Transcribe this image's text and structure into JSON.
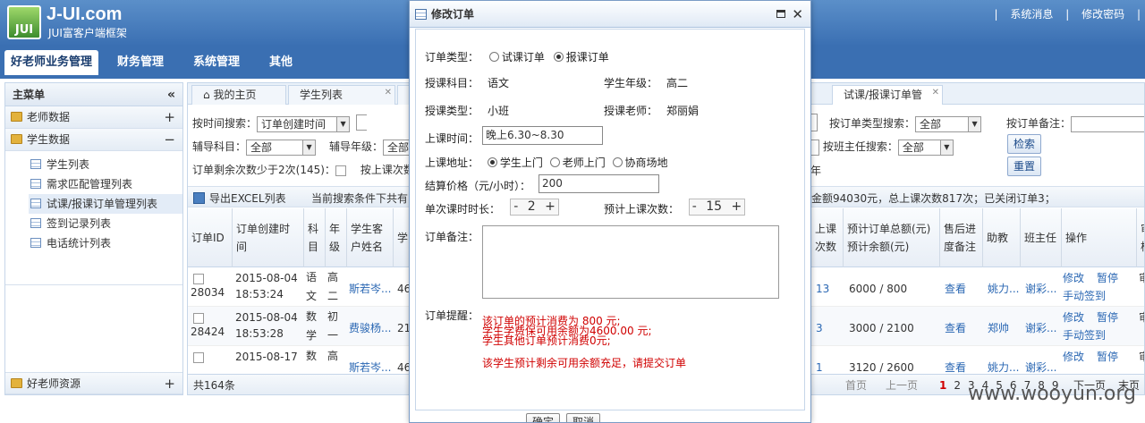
{
  "header": {
    "logo_text": "JUI",
    "title": "J-UI.com",
    "subtitle": "JUI富客户端框架",
    "links": [
      "|",
      "系统消息",
      "|",
      "修改密码",
      "|"
    ]
  },
  "nav": {
    "items": [
      "好老师业务管理",
      "财务管理",
      "系统管理",
      "其他"
    ]
  },
  "sidebar": {
    "title": "主菜单",
    "collapse": "«",
    "sections": [
      {
        "label": "老师数据",
        "toggle": "+"
      },
      {
        "label": "学生数据",
        "toggle": "−"
      }
    ],
    "items": [
      "学生列表",
      "需求匹配管理列表",
      "试课/报课订单管理列表",
      "签到记录列表",
      "电话统计列表"
    ],
    "bottom": {
      "label": "好老师资源",
      "toggle": "+"
    }
  },
  "tabs": [
    {
      "label": "我的主页"
    },
    {
      "label": "学生列表"
    },
    {
      "label": "试课/报课订单管"
    }
  ],
  "search": {
    "time_label": "按时间搜索：",
    "time_value": "订单创建时间",
    "subject_label": "辅导科目：",
    "subject_value": "全部",
    "grade_label": "辅导年级：",
    "grade_value": "全部",
    "remain_label": "订单剩余次数少于2次(145)：",
    "last_label": "按上课次数",
    "type_label": "按订单类型搜索：",
    "type_value": "全部",
    "note_label": "按订单备注：",
    "head_label": "按班主任搜索：",
    "head_value": "全部",
    "search_btn": "检索",
    "reset_btn": "重置",
    "nian": "年"
  },
  "toolbar": {
    "export": "导出EXCEL列表",
    "summary": "当前搜索条件下共有",
    "summary_right": "金额94030元，总上课次数817次；已关闭订单3；"
  },
  "grid": {
    "headers": [
      "订单ID",
      "订单创建时间",
      "科目",
      "年级",
      "学生客户姓名",
      "学",
      "上课次数",
      "预计订单总额(元) 预计余额(元)",
      "售后进度备注",
      "助教",
      "班主任",
      "操作",
      "审核"
    ],
    "rows": [
      {
        "id": "28034",
        "date": "2015-08-04",
        "time": "18:53:24",
        "subj": "语文",
        "grade": "高二",
        "name": "斯若岑...",
        "x": "46",
        "times": "13",
        "money": "6000 / 800",
        "view": "查看",
        "ta": "姚力...",
        "head": "谢彩...",
        "op1": "修改",
        "op2": "暂停",
        "op3": "手动签到",
        "aud": "审通"
      },
      {
        "id": "28424",
        "date": "2015-08-04",
        "time": "18:53:28",
        "subj": "数学",
        "grade": "初一",
        "name": "费骏杨...",
        "x": "21",
        "times": "3",
        "money": "3000 / 2100",
        "view": "查看",
        "ta": "郑帅",
        "head": "谢彩...",
        "op1": "修改",
        "op2": "暂停",
        "op3": "手动签到",
        "aud": "审通"
      },
      {
        "id": "",
        "date": "2015-08-17",
        "time": "",
        "subj": "数",
        "grade": "高",
        "name": "斯若岑...",
        "x": "46",
        "times": "1",
        "money": "3120 / 2600",
        "view": "查看",
        "ta": "姚力...",
        "head": "谢彩...",
        "op1": "修改",
        "op2": "暂停",
        "op3": "",
        "aud": "审"
      }
    ]
  },
  "pager": {
    "total": "共164条",
    "first": "首页",
    "prev": "上一页",
    "pages": [
      "1",
      "2",
      "3",
      "4",
      "5",
      "6",
      "7",
      "8",
      "9"
    ],
    "next": "下一页",
    "last": "末页"
  },
  "watermark": "www.wooyun.org",
  "dialog": {
    "title": "修改订单",
    "order_type_label": "订单类型：",
    "opt_trial": "试课订单",
    "opt_paid": "报课订单",
    "subject_label": "授课科目：",
    "subject": "语文",
    "grade_label": "学生年级：",
    "grade": "高二",
    "mode_label": "授课类型：",
    "mode": "小班",
    "teacher_label": "授课老师：",
    "teacher": "郑丽娟",
    "time_label": "上课时间：",
    "time_value": "晚上6.30~8.30",
    "addr_label": "上课地址：",
    "addr_opts": [
      "学生上门",
      "老师上门",
      "协商场地"
    ],
    "price_label": "结算价格（元/小时）：",
    "price_value": "200",
    "dur_label": "单次课时时长：",
    "dur_value": "2",
    "count_label": "预计上课次数：",
    "count_value": "15",
    "minus": "-",
    "plus": "+",
    "note_label": "订单备注：",
    "remind_label": "订单提醒：",
    "reminders": [
      "该订单的预计消费为 800 元;",
      "学生学费保可用余额为4600.00 元;",
      "学生其他订单预计消费0元;"
    ],
    "remind_final": "该学生预计剩余可用余额充足，请提交订单",
    "ok": "确定",
    "cancel": "取消"
  }
}
